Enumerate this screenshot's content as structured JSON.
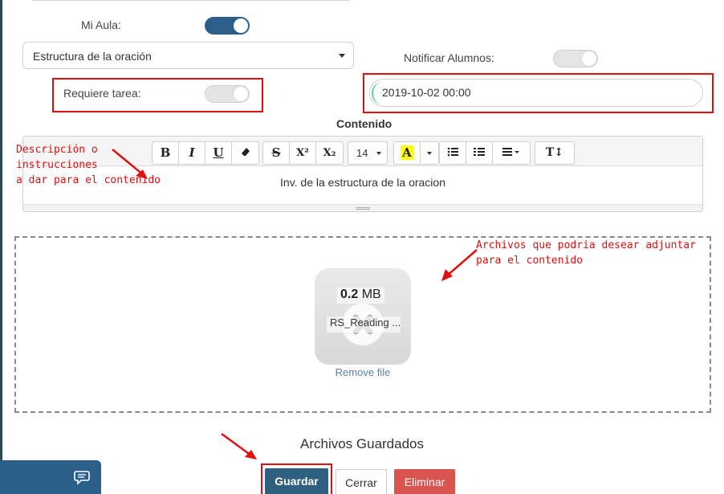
{
  "form": {
    "mi_aula_label": "Mi Aula:",
    "mi_aula_toggle": "on",
    "topic_select_value": "Estructura de la oración",
    "notificar_label": "Notificar Alumnos:",
    "notificar_toggle": "off",
    "requiere_label": "Requiere tarea:",
    "requiere_toggle": "off",
    "date_value": "2019-10-02 00:00",
    "contenido_label": "Contenido"
  },
  "toolbar": {
    "bold_icon": "B",
    "italic_icon": "I",
    "underline_icon": "U",
    "eraser_icon": "eraser",
    "strike_icon": "S",
    "superscript_icon": "X²",
    "subscript_icon": "X₂",
    "font_size_value": "14",
    "highlight_icon": "A",
    "bullet_list_icon": "bullet-list",
    "numbered_list_icon": "numbered-list",
    "align_icon": "align",
    "text_style_icon": "T↕"
  },
  "editor": {
    "content": "Inv. de la estructura de la oracion"
  },
  "annotations": {
    "description_note": [
      "Descripción o",
      "instrucciones",
      "a dar para el contenido"
    ],
    "files_note": [
      "Archivos que podria desear adjuntar",
      "para el contenido"
    ]
  },
  "dropzone": {
    "file_size_number": "0.2",
    "file_size_unit": "MB",
    "file_name": "RS_Reading ...",
    "remove_label": "Remove file"
  },
  "saved_section": {
    "heading": "Archivos Guardados"
  },
  "buttons": {
    "guardar": "Guardar",
    "cerrar": "Cerrar",
    "eliminar": "Eliminar"
  },
  "colors": {
    "primary": "#2b5f8a",
    "danger": "#d9534f",
    "annotation_red": "#e01010",
    "guardar_bg": "#2e5f7e"
  }
}
